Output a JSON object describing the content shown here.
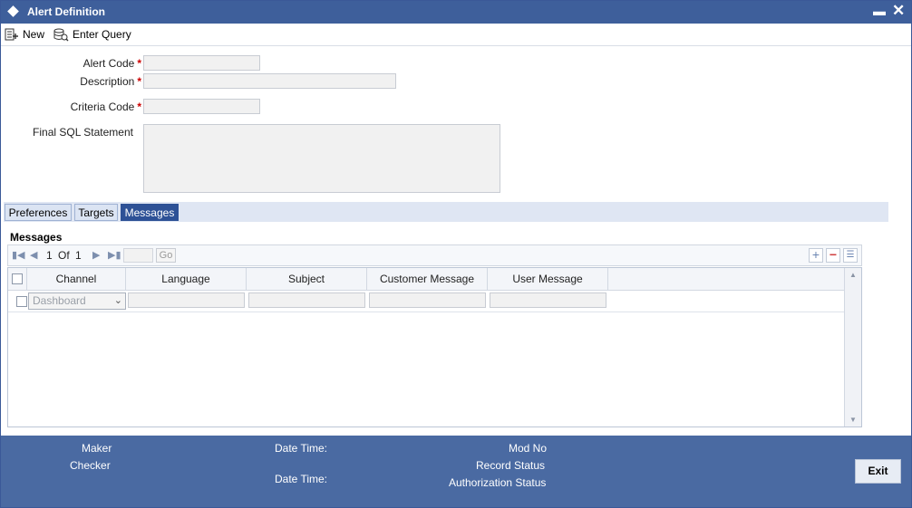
{
  "window": {
    "title": "Alert Definition"
  },
  "toolbar": {
    "new_label": "New",
    "enter_query_label": "Enter Query"
  },
  "form": {
    "alert_code_label": "Alert Code",
    "description_label": "Description",
    "criteria_code_label": "Criteria Code",
    "final_sql_label": "Final SQL Statement",
    "required_mark": "*",
    "alert_code_value": "",
    "description_value": "",
    "criteria_code_value": "",
    "final_sql_value": ""
  },
  "tabs": [
    {
      "label": "Preferences",
      "active": false
    },
    {
      "label": "Targets",
      "active": false
    },
    {
      "label": "Messages",
      "active": true
    }
  ],
  "messages": {
    "section_title": "Messages",
    "pager": {
      "current": "1",
      "of_label": "Of",
      "total": "1",
      "go_label": "Go"
    },
    "columns": [
      "Channel",
      "Language",
      "Subject",
      "Customer Message",
      "User Message"
    ],
    "rows": [
      {
        "channel": "Dashboard",
        "language": "",
        "subject": "",
        "customer_message": "",
        "user_message": ""
      }
    ]
  },
  "footer": {
    "maker_label": "Maker",
    "checker_label": "Checker",
    "date_time_label": "Date Time:",
    "mod_no_label": "Mod No",
    "record_status_label": "Record Status",
    "authorization_status_label": "Authorization Status",
    "exit_label": "Exit"
  },
  "colors": {
    "titlebar": "#3e5f9b",
    "footer": "#4a6aa2",
    "active_tab": "#2d5196",
    "required": "#cc0000"
  }
}
